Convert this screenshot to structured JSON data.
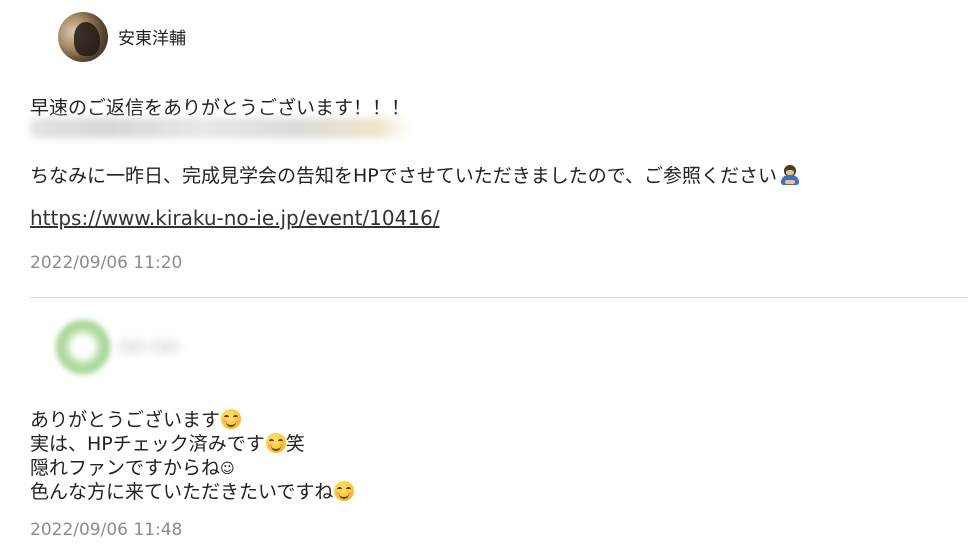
{
  "message1": {
    "author": "安東洋輔",
    "line1": "早速のご返信をありがとうございます！！！",
    "line3": "ちなみに一昨日、完成見学会の告知をHPでさせていただきましたので、ご参照ください",
    "line3_icon": "person-bowing-icon",
    "link": "https://www.kiraku-no-ie.jp/event/10416/",
    "timestamp": "2022/09/06 11:20"
  },
  "message2": {
    "lines": [
      {
        "text": "ありがとうございます",
        "icon": "smiling-face-emoji",
        "after": ""
      },
      {
        "text": "実は、HPチェック済みです",
        "icon": "smiling-face-emoji",
        "after": "笑"
      },
      {
        "text": "隠れファンですからね",
        "icon": "",
        "after": "☺"
      },
      {
        "text": "色んな方に来ていただきたいですね",
        "icon": "smiling-face-emoji",
        "after": ""
      }
    ],
    "timestamp": "2022/09/06 11:48"
  },
  "colors": {
    "background": "#ffffff",
    "text": "#222222",
    "timestamp": "#8c8c8c",
    "divider": "#dcdcdc"
  }
}
